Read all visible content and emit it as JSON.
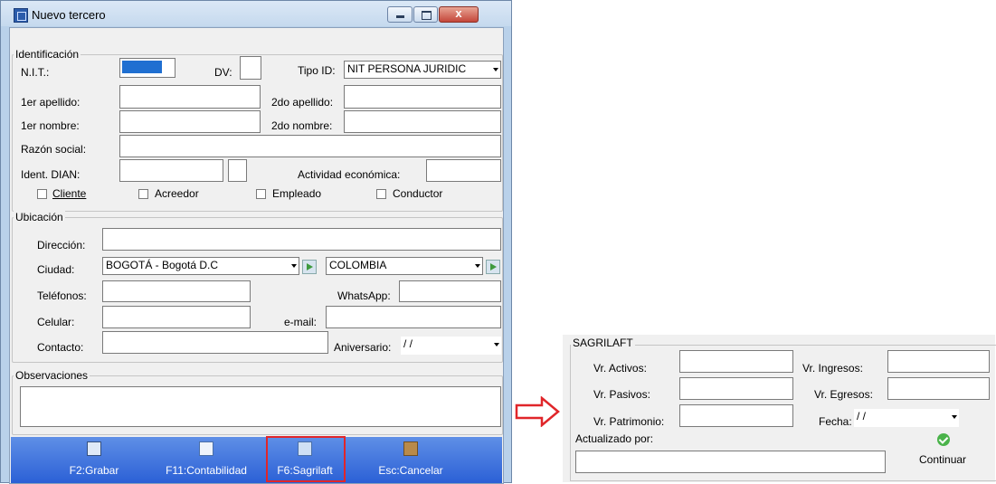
{
  "window": {
    "title": "Nuevo tercero",
    "close_glyph": "x"
  },
  "identificacion": {
    "legend": "Identificación",
    "nit_label": "N.I.T.:",
    "dv_label": "DV:",
    "tipo_id_label": "Tipo ID:",
    "tipo_id_value": "NIT PERSONA JURIDIC",
    "apellido1_label": "1er apellido:",
    "apellido2_label": "2do apellido:",
    "nombre1_label": "1er nombre:",
    "nombre2_label": "2do nombre:",
    "razon_label": "Razón social:",
    "dian_label": "Ident. DIAN:",
    "actividad_label": "Actividad económica:",
    "checkboxes": [
      "Cliente",
      "Acreedor",
      "Empleado",
      "Conductor"
    ]
  },
  "ubicacion": {
    "legend": "Ubicación",
    "direccion_label": "Dirección:",
    "ciudad_label": "Ciudad:",
    "ciudad_value": "BOGOTÁ - Bogotá D.C",
    "pais_value": "COLOMBIA",
    "telefonos_label": "Teléfonos:",
    "whatsapp_label": "WhatsApp:",
    "celular_label": "Celular:",
    "email_label": "e-mail:",
    "contacto_label": "Contacto:",
    "aniversario_label": "Aniversario:",
    "aniversario_value": " / /"
  },
  "observaciones": {
    "legend": "Observaciones"
  },
  "toolbar": {
    "grabar": "F2:Grabar",
    "contabilidad": "F11:Contabilidad",
    "sagrilaft": "F6:Sagrilaft",
    "cancelar": "Esc:Cancelar"
  },
  "sagrilaft": {
    "legend": "SAGRILAFT",
    "activos_label": "Vr. Activos:",
    "ingresos_label": "Vr. Ingresos:",
    "pasivos_label": "Vr. Pasivos:",
    "egresos_label": "Vr. Egresos:",
    "patrimonio_label": "Vr. Patrimonio:",
    "fecha_label": "Fecha:",
    "fecha_value": " / /",
    "actualizado_label": "Actualizado por:",
    "continuar_label": "Continuar"
  },
  "colors": {
    "highlight": "#e0262a",
    "toolbar": "#3a6ee0",
    "nit_fill": "#1f6fd1"
  }
}
